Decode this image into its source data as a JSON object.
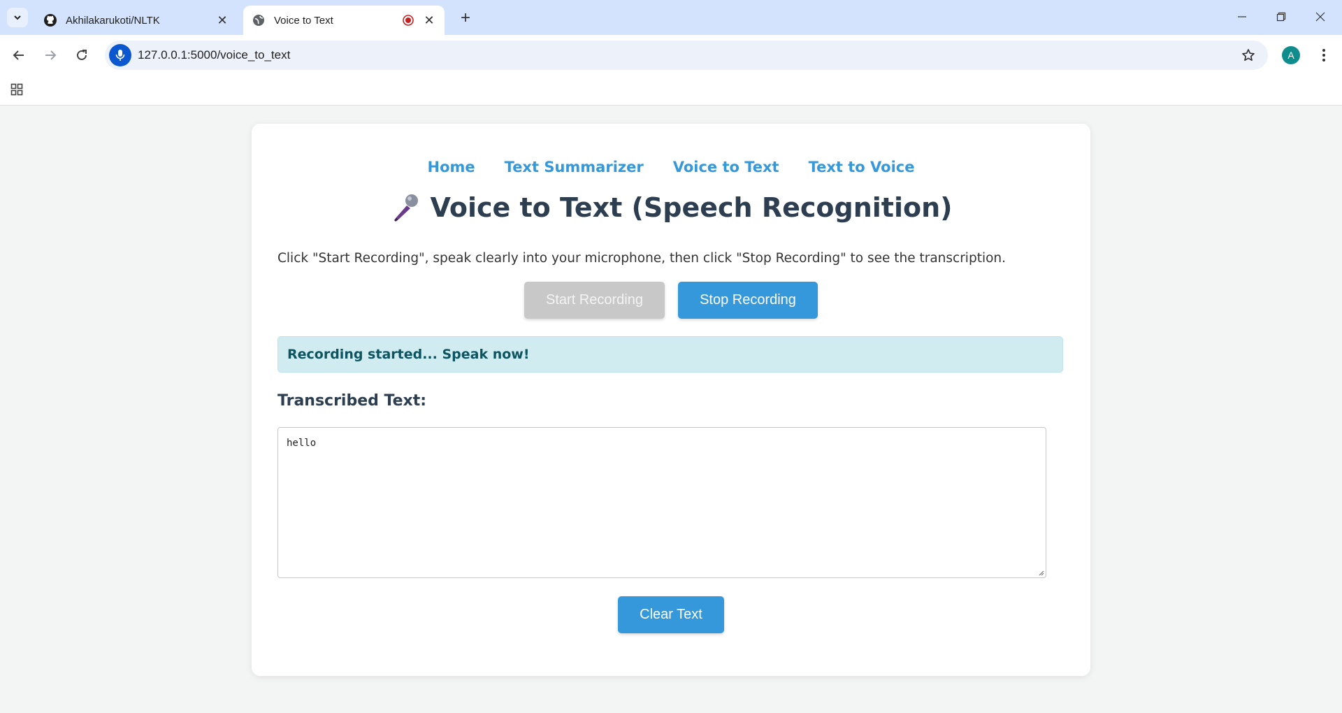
{
  "browser": {
    "tabs": [
      {
        "title": "Akhilakarukoti/NLTK",
        "favicon": "github-icon",
        "active": false
      },
      {
        "title": "Voice to Text",
        "favicon": "globe-icon",
        "active": true,
        "recording": true
      }
    ],
    "address": "127.0.0.1:5000/voice_to_text",
    "profile_initial": "A",
    "colors": {
      "tabstrip": "#d3e3fd",
      "omnibox": "#edf2fa",
      "mic_badge": "#0b57d0",
      "avatar": "#0f8c8c"
    }
  },
  "page": {
    "nav": {
      "home": "Home",
      "summarizer": "Text Summarizer",
      "voice_to_text": "Voice to Text",
      "text_to_voice": "Text to Voice"
    },
    "heading_icon": "microphone-icon",
    "heading": "Voice to Text (Speech Recognition)",
    "instructions": "Click \"Start Recording\", speak clearly into your microphone, then click \"Stop Recording\" to see the transcription.",
    "buttons": {
      "start": "Start Recording",
      "stop": "Stop Recording",
      "clear": "Clear Text"
    },
    "status": "Recording started... Speak now!",
    "transcribed_label": "Transcribed Text:",
    "transcribed_value": "hello",
    "colors": {
      "accent": "#3498db",
      "heading": "#2c3e50",
      "status_bg": "#d1ecf1",
      "status_text": "#0c5460",
      "disabled": "#c8c8c8"
    }
  }
}
